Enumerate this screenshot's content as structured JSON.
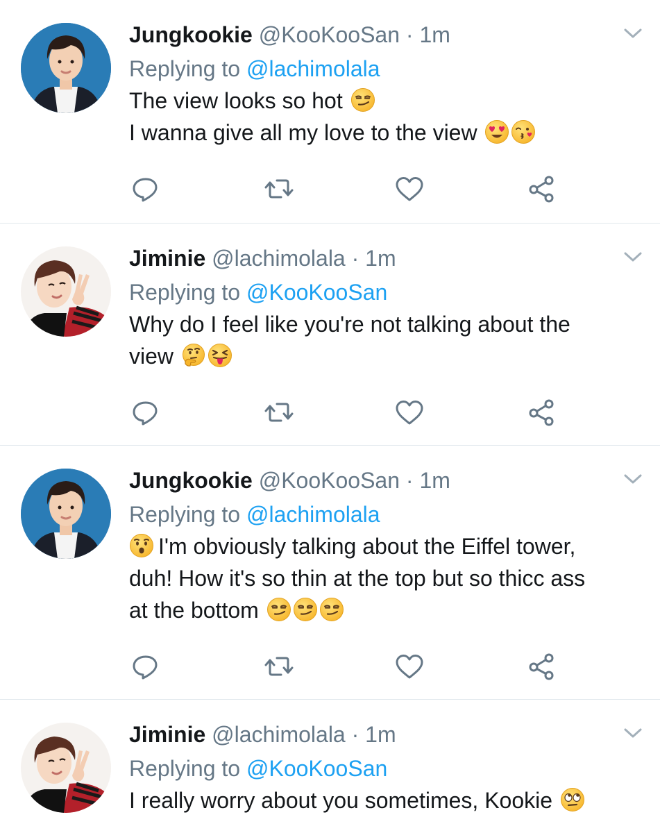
{
  "tweets": [
    {
      "name": "Jungkookie",
      "handle": "@KooKooSan",
      "time": "1m",
      "replying_prefix": "Replying to",
      "replying_to": "@lachimolala",
      "lines": [
        "The view looks so hot",
        "I wanna give all my love to the view"
      ],
      "emojis": [
        "smirking-face",
        "heart-eyes-face",
        "face-blowing-kiss"
      ]
    },
    {
      "name": "Jiminie",
      "handle": "@lachimolala",
      "time": "1m",
      "replying_prefix": "Replying to",
      "replying_to": "@KooKooSan",
      "lines": [
        "Why do I feel like you're not talking about the",
        "view"
      ],
      "emojis": [
        "thinking-face",
        "squinting-face-with-tongue"
      ]
    },
    {
      "name": "Jungkookie",
      "handle": "@KooKooSan",
      "time": "1m",
      "replying_prefix": "Replying to",
      "replying_to": "@lachimolala",
      "lines": [
        "I'm obviously talking about the Eiffel tower,",
        "duh! How it's so thin at the top but so thicc ass",
        "at the bottom"
      ],
      "emojis": [
        "hushed-face",
        "smirking-face",
        "smirking-face",
        "smirking-face"
      ]
    },
    {
      "name": "Jiminie",
      "handle": "@lachimolala",
      "time": "1m",
      "replying_prefix": "Replying to",
      "replying_to": "@KooKooSan",
      "lines": [
        "I really worry about you sometimes, Kookie"
      ],
      "emojis": [
        "face-with-rolling-eyes"
      ]
    }
  ],
  "separator": " · ",
  "icons": [
    "reply-icon",
    "retweet-icon",
    "like-icon",
    "share-icon",
    "chevron-down-icon"
  ],
  "colors": {
    "mention": "#1da1f2",
    "meta": "#657786",
    "icon": "#657786",
    "divider": "#e1e8ed"
  }
}
